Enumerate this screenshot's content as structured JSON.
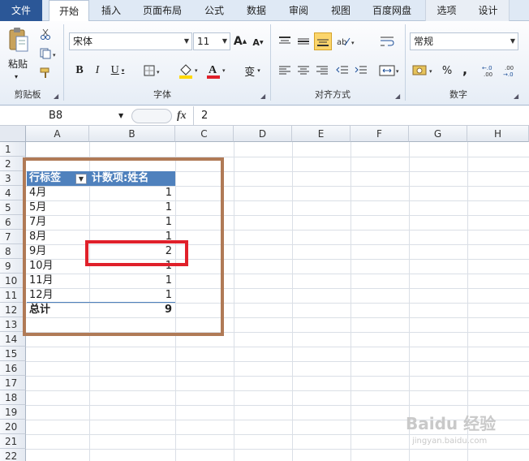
{
  "tabs": [
    "文件",
    "开始",
    "插入",
    "页面布局",
    "公式",
    "数据",
    "审阅",
    "视图",
    "百度网盘",
    "选项",
    "设计"
  ],
  "clipboard": {
    "paste": "粘贴",
    "label": "剪贴板"
  },
  "font": {
    "name": "宋体",
    "size": "11",
    "label": "字体",
    "bold": "B",
    "italic": "I",
    "underline": "U",
    "grow": "A",
    "shrink": "A",
    "color_letter": "A",
    "phonetic": "变"
  },
  "alignment": {
    "label": "对齐方式"
  },
  "number": {
    "format": "常规",
    "label": "数字",
    "percent": "%",
    "comma": ",",
    "inc_decimal": "+.0\n.00",
    "dec_decimal": ".00\n→.0"
  },
  "formula": {
    "name_box": "B8",
    "fx": "fx",
    "value": "2"
  },
  "columns": [
    "A",
    "B",
    "C",
    "D",
    "E",
    "F",
    "G",
    "H"
  ],
  "rows": [
    "1",
    "2",
    "3",
    "4",
    "5",
    "6",
    "7",
    "8",
    "9",
    "10",
    "11",
    "12",
    "13",
    "14",
    "15",
    "16",
    "17",
    "18",
    "19",
    "20",
    "21",
    "22"
  ],
  "pivot": {
    "header_a": "行标签",
    "header_b": "计数项:姓名",
    "rows": [
      {
        "label": "4月",
        "value": "1"
      },
      {
        "label": "5月",
        "value": "1"
      },
      {
        "label": "7月",
        "value": "1"
      },
      {
        "label": "8月",
        "value": "1"
      },
      {
        "label": "9月",
        "value": "2"
      },
      {
        "label": "10月",
        "value": "1"
      },
      {
        "label": "11月",
        "value": "1"
      },
      {
        "label": "12月",
        "value": "1"
      }
    ],
    "total_label": "总计",
    "total_value": "9"
  },
  "watermark": {
    "line1": "Baidu 经验",
    "line2": "jingyan.baidu.com"
  },
  "colors": {
    "accent": "#2b5797",
    "pivot_header": "#4f81bd",
    "highlight": "#e0202a",
    "frame": "#b07a56"
  }
}
